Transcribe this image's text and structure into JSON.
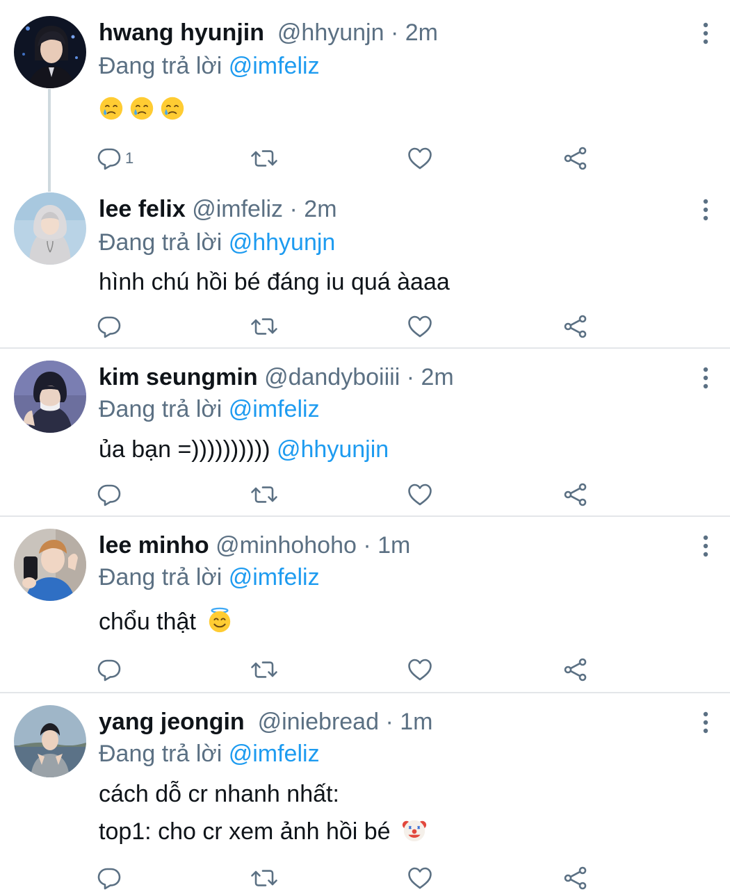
{
  "tweets": [
    {
      "display_name": "hwang hyunjin",
      "handle": "@hhyunjn",
      "time": "· 2m",
      "reply_prefix": "Đang trả lời",
      "reply_to": "@imfeliz",
      "body_emojis": [
        "crying-face",
        "crying-face",
        "crying-face"
      ],
      "reply_count": "1"
    },
    {
      "display_name": "lee felix",
      "handle": "@imfeliz",
      "time": "· 2m",
      "reply_prefix": "Đang trả lời",
      "reply_to": "@hhyunjn",
      "body": "hình chú hồi bé đáng iu quá àaaa"
    },
    {
      "display_name": "kim seungmin",
      "handle": "@dandyboiiii",
      "time": "· 2m",
      "reply_prefix": "Đang trả lời",
      "reply_to": "@imfeliz",
      "body": "ủa bạn =))))))))))",
      "body_mention": "@hhyunjin"
    },
    {
      "display_name": "lee minho",
      "handle": "@minhohoho",
      "time": "· 1m",
      "reply_prefix": "Đang trả lời",
      "reply_to": "@imfeliz",
      "body": "chổu thật",
      "body_emoji": "smiling-face-with-halo"
    },
    {
      "display_name": "yang jeongin",
      "handle": "@iniebread",
      "time": "· 1m",
      "reply_prefix": "Đang trả lời",
      "reply_to": "@imfeliz",
      "body_line1": "cách dỗ cr nhanh nhất:",
      "body_line2": "top1: cho cr xem ảnh hồi bé",
      "body_emoji": "clown-face"
    }
  ],
  "colors": {
    "link": "#1d9bf0",
    "muted": "#5b7083",
    "text": "#0f1419",
    "divider": "#e3e6e9",
    "thread_line": "#cfd9de"
  },
  "icons": {
    "reply": "reply-icon",
    "retweet": "retweet-icon",
    "like": "heart-icon",
    "share": "share-icon",
    "more": "more-vertical-icon"
  }
}
